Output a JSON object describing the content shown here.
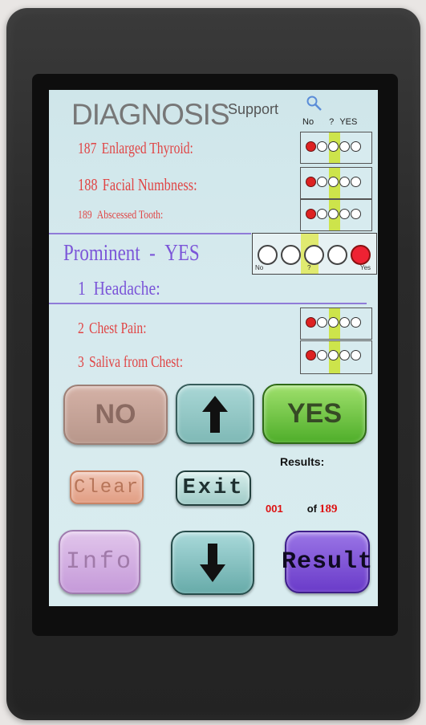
{
  "header": {
    "title": "DIAGNOSIS",
    "subtitle": "Support",
    "scale_no": "No",
    "scale_unsure": "?",
    "scale_yes": "YES"
  },
  "previous_items": [
    {
      "num": "187",
      "label": "Enlarged Thyroid:"
    },
    {
      "num": "188",
      "label": "Facial Numbness:"
    },
    {
      "num": "189",
      "label": "Abscessed Tooth:"
    }
  ],
  "prominent": {
    "label": "Prominent",
    "dash": "-",
    "value": "YES",
    "scale_labels": [
      "No",
      "?",
      "Yes"
    ],
    "selected_index": 4
  },
  "current": {
    "num": "1",
    "label": "Headache:"
  },
  "next_items": [
    {
      "num": "2",
      "label": "Chest Pain:"
    },
    {
      "num": "3",
      "label": "Saliva from Chest:"
    }
  ],
  "buttons": {
    "no": "NO",
    "yes": "YES",
    "clear": "Clear",
    "exit": "Exit",
    "info": "Info",
    "result": "Result"
  },
  "results": {
    "label": "Results:",
    "current": "001",
    "of": "of",
    "total": "189"
  },
  "colors": {
    "screen_bg": "#d6eaee",
    "item_red": "#e04545",
    "accent_purple": "#7b55d8",
    "yes_green": "#4fae2a",
    "band_yellow": "#cde44b"
  }
}
